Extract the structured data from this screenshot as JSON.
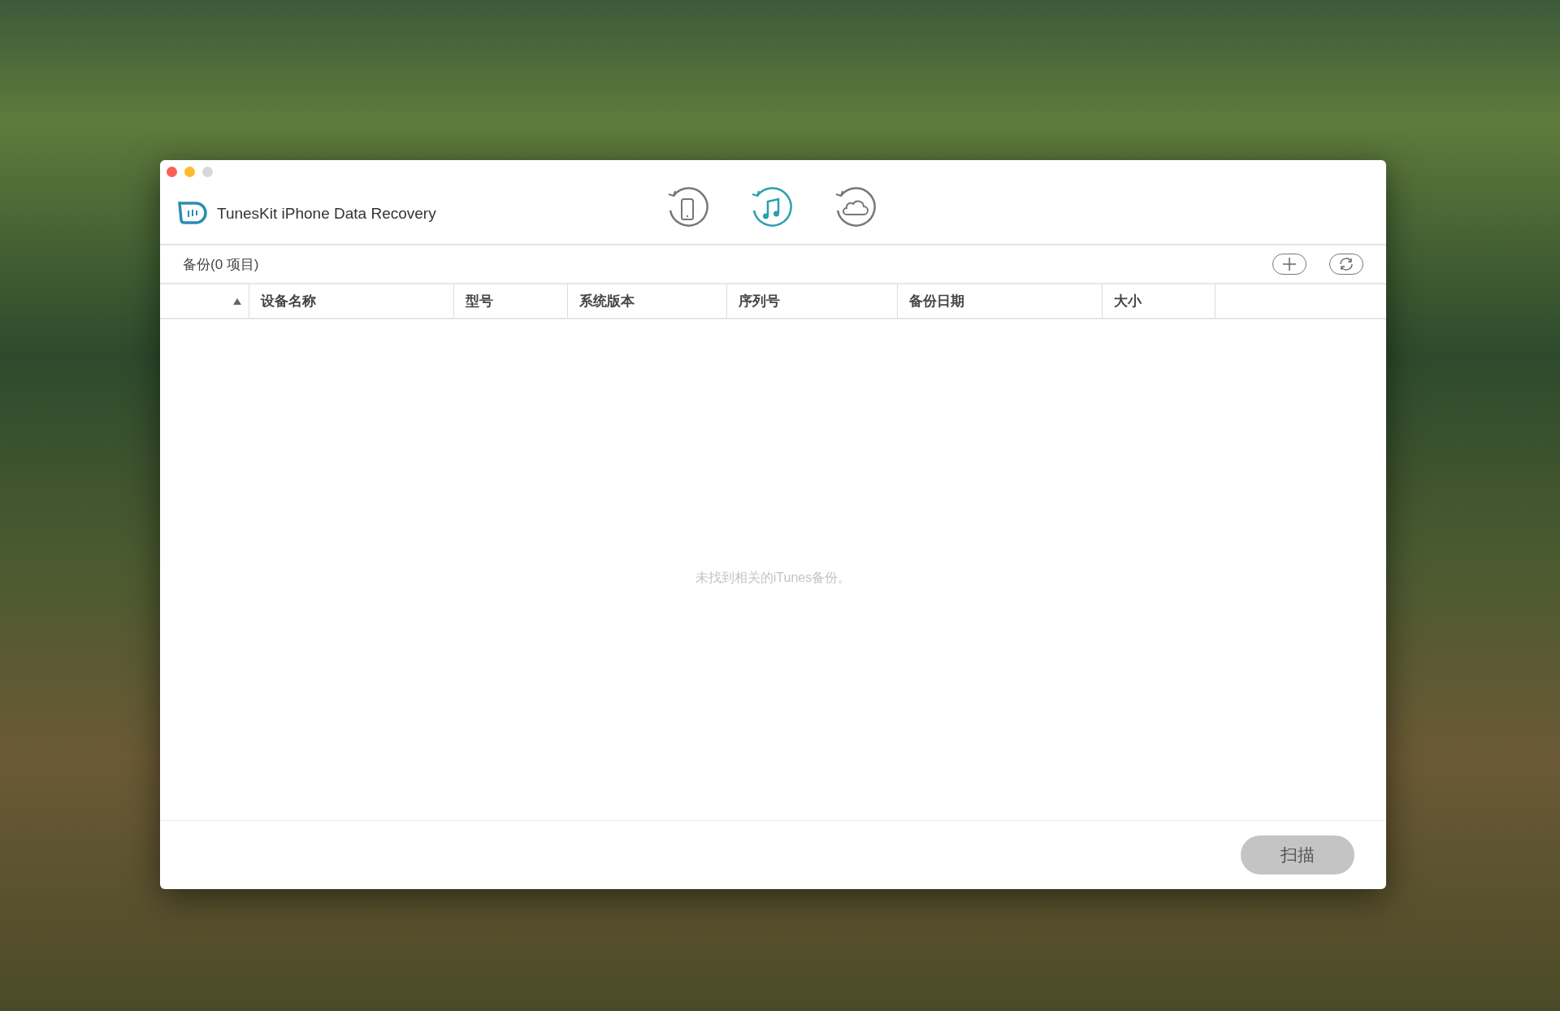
{
  "window": {
    "title": "TunesKit iPhone Data Recovery"
  },
  "modes": [
    {
      "kind": "device",
      "selected": false
    },
    {
      "kind": "itunes",
      "selected": true
    },
    {
      "kind": "icloud",
      "selected": false
    }
  ],
  "toolbar": {
    "label": "备份(0 项目)"
  },
  "table": {
    "columns": [
      {
        "label": "设备名称"
      },
      {
        "label": "型号"
      },
      {
        "label": "系统版本"
      },
      {
        "label": "序列号"
      },
      {
        "label": "备份日期"
      },
      {
        "label": "大小"
      }
    ],
    "empty_message": "未找到相关的iTunes备份。"
  },
  "scan_button": {
    "label": "扫描",
    "disabled": true
  }
}
